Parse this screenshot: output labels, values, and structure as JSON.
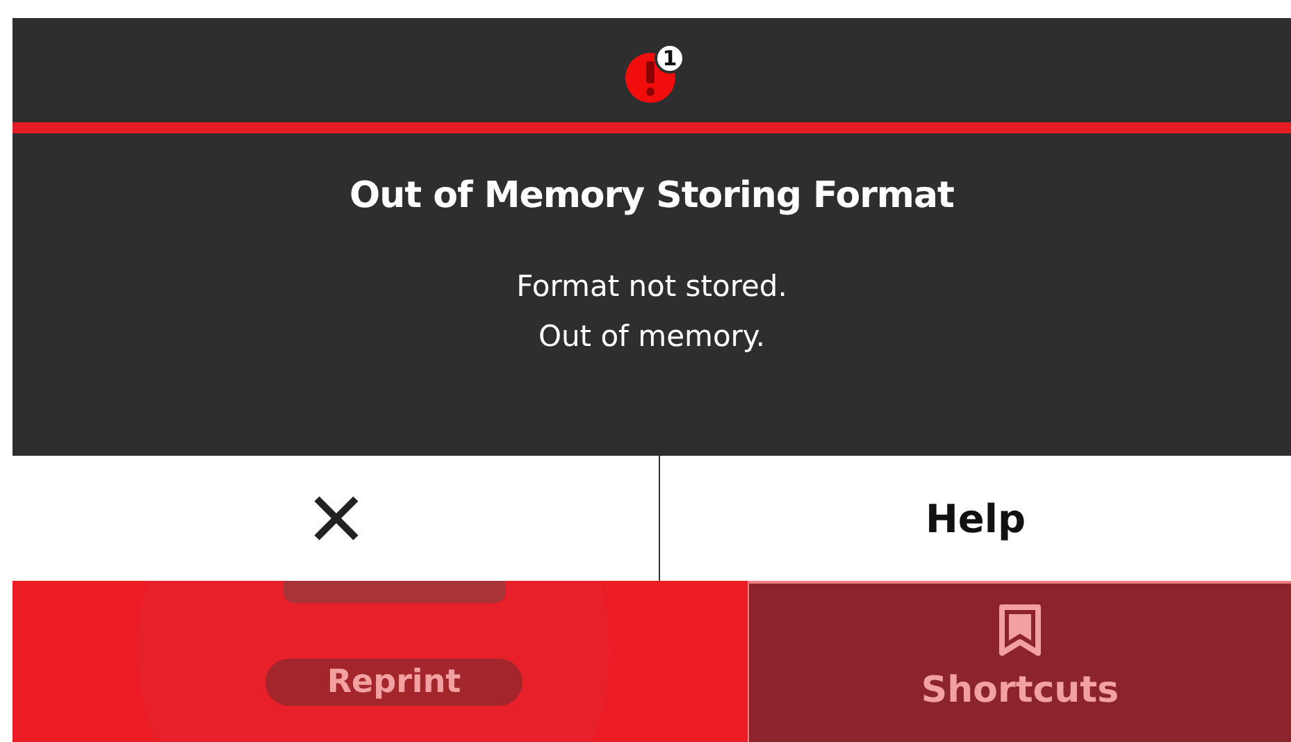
{
  "status_bar": {
    "alert_count": "1"
  },
  "dialog": {
    "title": "Out of Memory Storing Format",
    "message": [
      "Format not stored.",
      "Out of memory."
    ],
    "buttons": [
      {
        "kind": "close"
      },
      {
        "kind": "text",
        "label": "Help"
      }
    ]
  },
  "home": {
    "reprint": {
      "label": "Reprint"
    },
    "shortcuts": {
      "label": "Shortcuts"
    }
  }
}
